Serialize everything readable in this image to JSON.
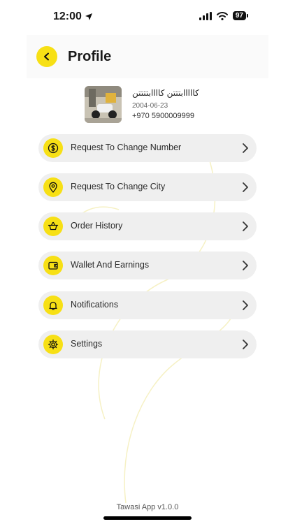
{
  "status_bar": {
    "time": "12:00",
    "battery": "97"
  },
  "header": {
    "title": "Profile"
  },
  "profile": {
    "name": "كااااابتتتن كاااابتتتتن",
    "date": "2004-06-23",
    "phone": "+970 5900009999"
  },
  "menu": [
    {
      "label": "Request To Change Number",
      "icon": "dollar-cycle-icon"
    },
    {
      "label": "Request To Change City",
      "icon": "location-pin-icon"
    },
    {
      "label": "Order History",
      "icon": "basket-icon"
    },
    {
      "label": "Wallet And Earnings",
      "icon": "wallet-icon"
    },
    {
      "label": "Notifications",
      "icon": "bell-icon"
    },
    {
      "label": "Settings",
      "icon": "gear-icon"
    }
  ],
  "footer": {
    "version": "Tawasi App v1.0.0"
  },
  "colors": {
    "accent": "#f7e015",
    "item_bg": "#efefef",
    "text": "#1a1a1a"
  }
}
